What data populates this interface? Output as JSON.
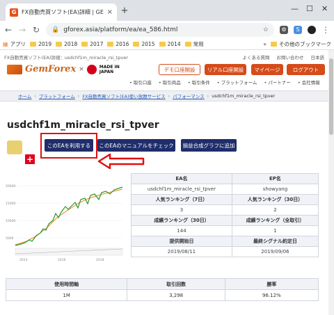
{
  "browser": {
    "tab_title": "FX自動売買ソフト(EA)詳細 | GEM",
    "tab_close": "×",
    "new_tab": "+",
    "url": "gforex.asia/platform/ea/ea_586.html",
    "win_min": "—",
    "win_max": "☐",
    "win_close": "✕",
    "bookmarks": [
      "アプリ",
      "2019",
      "2018",
      "2017",
      "2016",
      "2015",
      "2014",
      "常用",
      "»",
      "その他のブックマーク"
    ]
  },
  "header": {
    "page_top": "FX自動売買ソフト(EA)詳細：usdchf1m_miracle_rsi_tpver",
    "top_links": [
      "よくある質問",
      "お問い合わせ",
      "日本語"
    ],
    "logo_text": "GemForex",
    "logo_x": "×",
    "japan_text": "MADE IN JAPAN",
    "btn_demo": "デモ口座開設",
    "btn_real": "リアル口座開設",
    "btn_mypage": "マイページ",
    "btn_login": "ログアウト",
    "subnav": [
      "• 取引口座",
      "• 取引商品",
      "• 取引条件",
      "• プラットフォーム",
      "• パートナー",
      "• 会社情報"
    ]
  },
  "breadcrumb": [
    "ホーム",
    "プラットフォーム",
    "FX自動売買ソフト(EA)使い放題サービス",
    "パフォーマンス",
    "usdchf1m_miracle_rsi_tpver"
  ],
  "ea": {
    "title": "usdchf1m_miracle_rsi_tpver",
    "btn_use": "このEAを利用する",
    "btn_manual": "このEAのマニュアルをチェック",
    "btn_graph": "損益合成グラフに追加"
  },
  "info": {
    "rows": [
      [
        "EA名",
        "EP名"
      ],
      [
        "usdchf1m_miracle_rsi_tpver",
        "showyang"
      ],
      [
        "人気ランキング（7日）",
        "人気ランキング（30日）"
      ],
      [
        "3",
        "2"
      ],
      [
        "成績ランキング（30日）",
        "成績ランキング（全取引）"
      ],
      [
        "144",
        "1"
      ],
      [
        "提供開始日",
        "最終シグナル約定日"
      ],
      [
        "2019/08/11",
        "2019/09/06"
      ]
    ]
  },
  "stats": {
    "headers": [
      "使用時間軸",
      "取引回数",
      "勝率"
    ],
    "values": [
      "1M",
      "3,298",
      "96.12%"
    ]
  },
  "chart": {
    "y_labels": [
      "20000",
      "15000",
      "10000",
      "5000"
    ],
    "x_labels": [
      "2014",
      "2016",
      "2018"
    ],
    "line_color": "#2a9a2a",
    "balance_color": "#f08020"
  }
}
